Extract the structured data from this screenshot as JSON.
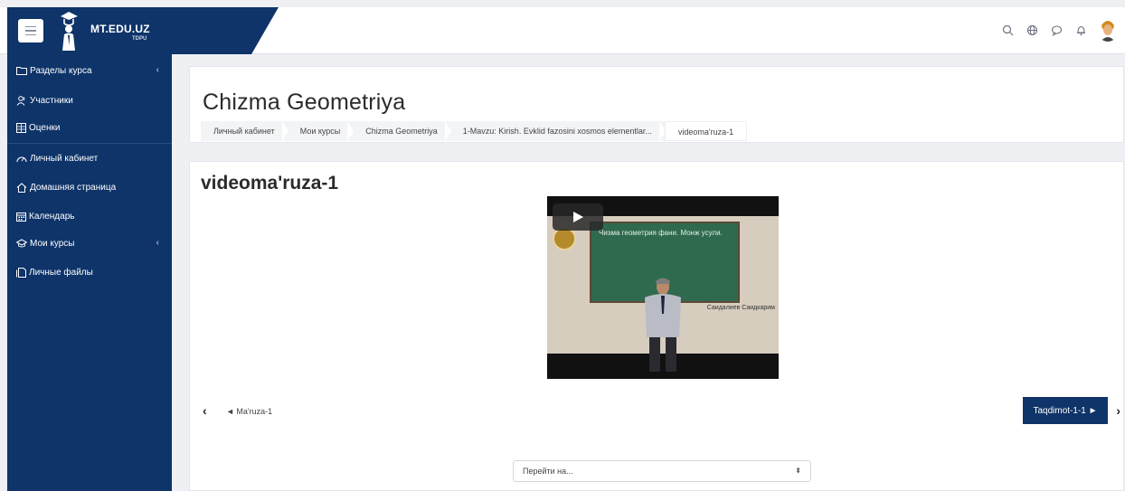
{
  "header": {
    "brand": "MT.EDU.UZ",
    "brand_sub": "TDPU",
    "icons": [
      "search-icon",
      "globe-icon",
      "chat-icon",
      "bell-icon",
      "avatar"
    ]
  },
  "sidebar": {
    "items": [
      {
        "label": "Разделы курса",
        "icon": "folder-icon",
        "chevron": "‹"
      },
      {
        "label": "Участники",
        "icon": "users-icon"
      },
      {
        "label": "Оценки",
        "icon": "table-icon"
      },
      {
        "label": "Личный кабинет",
        "icon": "dashboard-icon"
      },
      {
        "label": "Домашняя страница",
        "icon": "home-icon"
      },
      {
        "label": "Календарь",
        "icon": "calendar-icon"
      },
      {
        "label": "Мои курсы",
        "icon": "graduation-cap-icon",
        "chevron": "‹"
      },
      {
        "label": "Личные файлы",
        "icon": "files-icon"
      }
    ]
  },
  "page": {
    "title": "Chizma Geometriya",
    "breadcrumb": [
      "Личный кабинет",
      "Мои курсы",
      "Chizma Geometriya",
      "1-Mavzu: Kirish. Evklid fazosini xosmos elementlar...",
      "videoma'ruza-1"
    ]
  },
  "content": {
    "title": "videoma'ruza-1",
    "video": {
      "board_text": "Чизма геометрия фани. Монж усули.",
      "caption": "Саидалиев Саидкарим"
    },
    "prev_link": "◄ Ma'ruza-1",
    "prev_chevron": "‹",
    "next_button": "Taqdimot-1-1 ►",
    "next_chevron": "›",
    "jump_placeholder": "Перейти на...",
    "jump_arrow": "⬍"
  }
}
